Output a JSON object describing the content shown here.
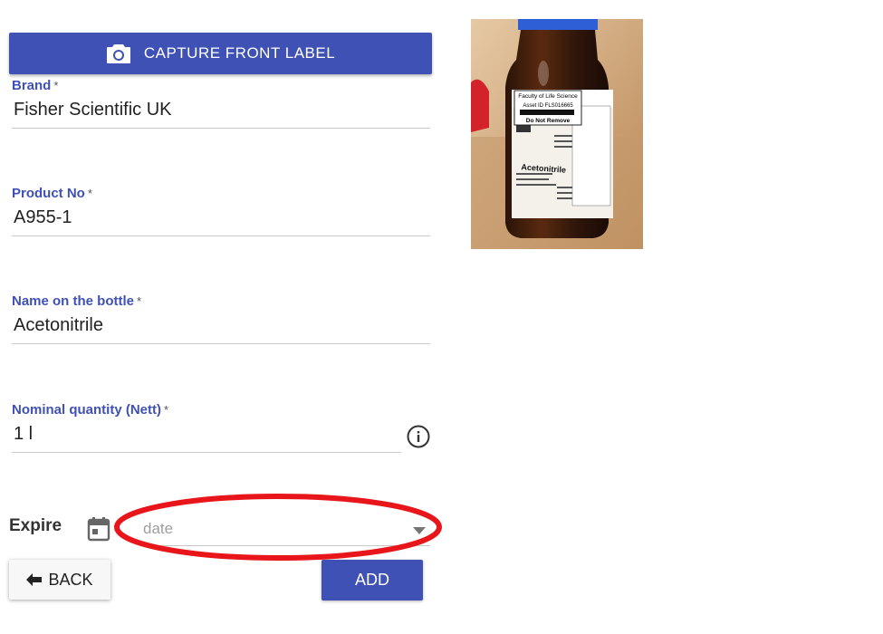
{
  "capture_button": {
    "label": "CAPTURE FRONT LABEL",
    "icon": "camera-icon"
  },
  "fields": {
    "brand": {
      "label": "Brand",
      "required_mark": "*",
      "value": "Fisher Scientific UK"
    },
    "product_no": {
      "label": "Product No",
      "required_mark": "*",
      "value": "A955-1"
    },
    "name_on_bottle": {
      "label": "Name on the bottle",
      "required_mark": "*",
      "value": "Acetonitrile"
    },
    "nominal_quantity": {
      "label": "Nominal quantity (Nett)",
      "required_mark": "*",
      "value": "1 l",
      "info_icon": "info-icon"
    }
  },
  "expire": {
    "label": "Expire",
    "placeholder": "date",
    "icon": "calendar-icon"
  },
  "actions": {
    "back_label": "BACK",
    "add_label": "ADD"
  },
  "photo": {
    "label_lines": [
      "Faculty of Life Science",
      "Asset ID  FLS016665",
      "Do Not Remove"
    ],
    "product_text": "Acetonitrile"
  },
  "colors": {
    "primary": "#3f51b5",
    "annotation_red": "#e8161b"
  }
}
